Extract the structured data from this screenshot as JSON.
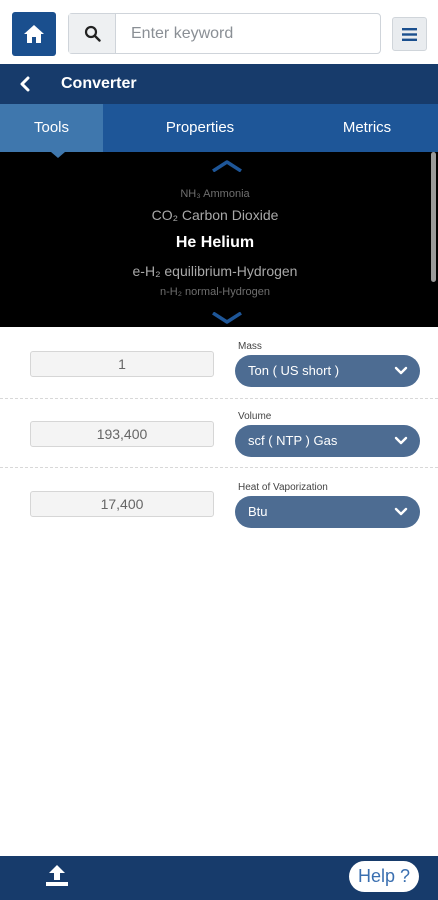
{
  "search": {
    "placeholder": "Enter keyword"
  },
  "header": {
    "title": "Converter"
  },
  "tabs": [
    {
      "label": "Tools",
      "active": true
    },
    {
      "label": "Properties",
      "active": false
    },
    {
      "label": "Metrics",
      "active": false
    }
  ],
  "picker": {
    "items": [
      {
        "label": "NH₃ Ammonia"
      },
      {
        "label": "CO₂ Carbon Dioxide"
      },
      {
        "label": "He Helium",
        "selected": true
      },
      {
        "label": "e-H₂ equilibrium-Hydrogen"
      },
      {
        "label": "n-H₂ normal-Hydrogen"
      }
    ]
  },
  "conversions": [
    {
      "label": "Mass",
      "value": "1",
      "unit": "Ton ( US short )"
    },
    {
      "label": "Volume",
      "value": "193,400",
      "unit": "scf ( NTP ) Gas"
    },
    {
      "label": "Heat of Vaporization",
      "value": "17,400",
      "unit": "Btu"
    }
  ],
  "footer": {
    "help_label": "Help ?"
  },
  "colors": {
    "navy": "#173b6b",
    "tab_bar": "#1e5698",
    "tab_active": "#3f77ad",
    "select_fill": "#4d6c92",
    "home_button": "#1a4f8e"
  },
  "icons": [
    "home-icon",
    "search-icon",
    "hamburger-menu-icon",
    "back-chevron-icon",
    "chevron-up-icon",
    "chevron-down-icon",
    "upload-icon"
  ]
}
